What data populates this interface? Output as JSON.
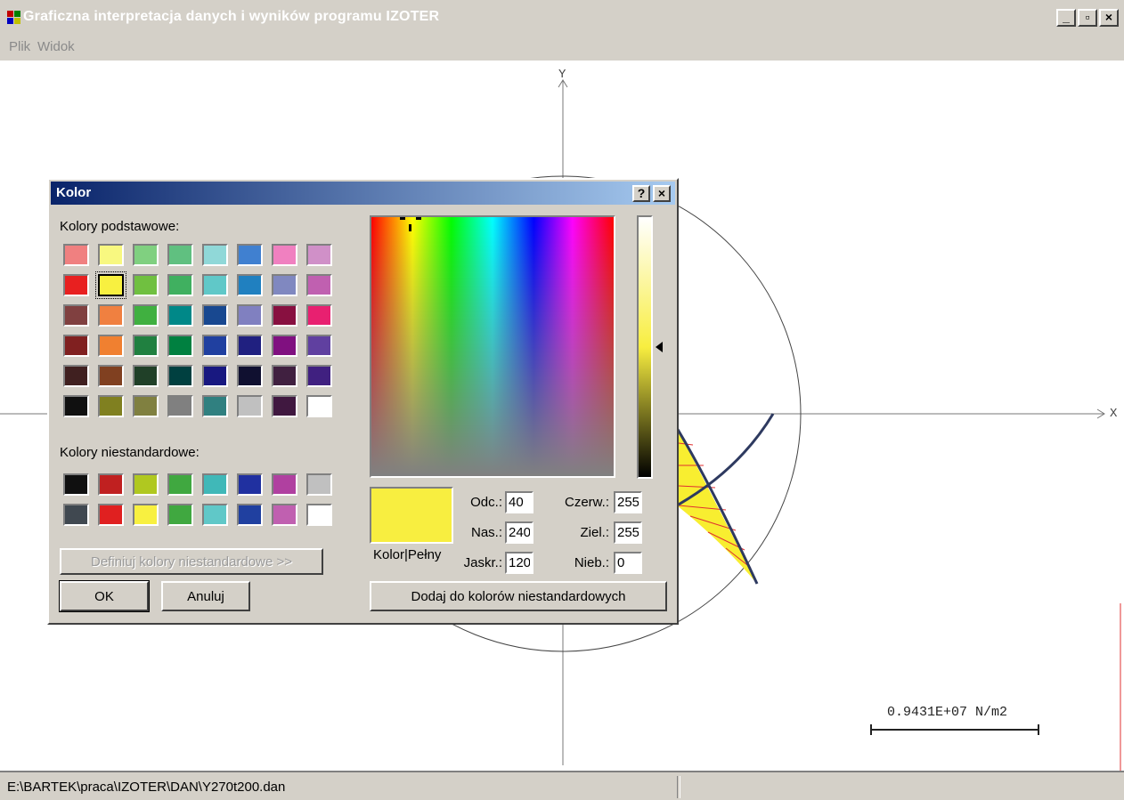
{
  "window": {
    "title": "Graficzna interpretacja danych i wyników programu IZOTER",
    "minimize_label": "_",
    "restore_label": "▫",
    "close_label": "×"
  },
  "menu": {
    "items": [
      "Plik",
      "Widok"
    ]
  },
  "canvas": {
    "axis_x_label": "X",
    "axis_y_label": "Y",
    "scale_label": "0.9431E+07 N/m2"
  },
  "statusbar": {
    "path": "E:\\BARTEK\\praca\\IZOTER\\DAN\\Y270t200.dan"
  },
  "dialog": {
    "title": "Kolor",
    "help_label": "?",
    "close_label": "×",
    "basic_colors_label": "Kolory podstawowe:",
    "basic_colors": [
      [
        "#f08080",
        "#f8f880",
        "#80d080",
        "#60c080",
        "#90d8d8",
        "#4080d0",
        "#f080c0",
        "#d090c8"
      ],
      [
        "#e82020",
        "#f8f040",
        "#70c040",
        "#40b060",
        "#60c8c8",
        "#2080c0",
        "#8088c0",
        "#c060b0"
      ],
      [
        "#804040",
        "#f08040",
        "#40b040",
        "#008888",
        "#184890",
        "#8080c0",
        "#881040",
        "#e82070"
      ],
      [
        "#802020",
        "#f08030",
        "#208040",
        "#008040",
        "#2040a0",
        "#202080",
        "#801080",
        "#6040a0"
      ],
      [
        "#402020",
        "#804020",
        "#204028",
        "#004040",
        "#181880",
        "#101030",
        "#402040",
        "#402080"
      ],
      [
        "#101010",
        "#808020",
        "#808040",
        "#808080",
        "#308080",
        "#c0c0c0",
        "#401840",
        "#ffffff"
      ]
    ],
    "selected_basic": [
      1,
      1
    ],
    "custom_colors_label": "Kolory niestandardowe:",
    "custom_colors": [
      [
        "#101010",
        "#c02020",
        "#b0c820",
        "#40a840",
        "#40b8b8",
        "#2030a0",
        "#b040a0",
        "#c0c0c0"
      ],
      [
        "#404850",
        "#e02020",
        "#f8f040",
        "#40a840",
        "#60c8c8",
        "#2040a0",
        "#c060b0",
        "#ffffff"
      ]
    ],
    "define_button": "Definiuj kolory niestandardowe >>",
    "ok_button": "OK",
    "cancel_button": "Anuluj",
    "preview_label": "Kolor|Pełny",
    "preview_color": "#f8ee40",
    "fields": {
      "hue_label": "Odc.:",
      "hue": "40",
      "sat_label": "Nas.:",
      "sat": "240",
      "lum_label": "Jaskr.:",
      "lum": "120",
      "red_label": "Czerw.:",
      "red": "255",
      "green_label": "Ziel.:",
      "green": "255",
      "blue_label": "Nieb.:",
      "blue": "0"
    },
    "luminance_level": 0.5,
    "add_custom_button": "Dodaj do kolorów niestandardowych"
  }
}
